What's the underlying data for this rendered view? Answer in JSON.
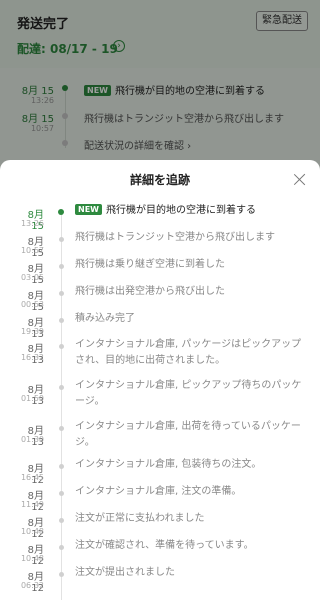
{
  "background": {
    "status_title": "発送完了",
    "urgent_button": "緊急配送",
    "delivery_label": "配達: 08/17 - 19",
    "chevron": "›",
    "rows": [
      {
        "date": "8月 15",
        "time": "13:26",
        "text": "飛行機が目的地の空港に到着する",
        "badge": "NEW"
      },
      {
        "date": "8月 15",
        "time": "10:57",
        "text": "飛行機はトランジット空港から飛び出します"
      },
      {
        "text": "配送状況の詳細を確認 ›"
      }
    ]
  },
  "sheet": {
    "title": "詳細を追跡",
    "events": [
      {
        "date": "8月 15",
        "time": "13:26",
        "text": "飛行機が目的地の空港に到着する",
        "badge": "NEW",
        "active": true
      },
      {
        "date": "8月 15",
        "time": "10:57",
        "text": "飛行機はトランジット空港から飛び出します"
      },
      {
        "date": "8月 15",
        "time": "03:05",
        "text": "飛行機は乗り継ぎ空港に到着した"
      },
      {
        "date": "8月 15",
        "time": "00:53",
        "text": "飛行機は出発空港から飛び出した"
      },
      {
        "date": "8月 13",
        "time": "19:39",
        "text": "積み込み完了"
      },
      {
        "date": "8月 13",
        "time": "16:32",
        "text": "インタナショナル倉庫, パッケージはピックアップされ、目的地に出荷されました。"
      },
      {
        "date": "8月 13",
        "time": "01:50",
        "text": "インタナショナル倉庫, ピックアップ待ちのパッケージ。"
      },
      {
        "date": "8月 13",
        "time": "01:30",
        "text": "インタナショナル倉庫, 出荷を待っているパッケージ。"
      },
      {
        "date": "8月 12",
        "time": "16:45",
        "text": "インタナショナル倉庫, 包装待ちの注文。"
      },
      {
        "date": "8月 12",
        "time": "11:49",
        "text": "インタナショナル倉庫, 注文の準備。"
      },
      {
        "date": "8月 12",
        "time": "10:48",
        "text": "注文が正常に支払われました"
      },
      {
        "date": "8月 12",
        "time": "10:48",
        "text": "注文が確認され、準備を待っています。"
      },
      {
        "date": "8月 12",
        "time": "06:32",
        "text": "注文が提出されました"
      }
    ]
  },
  "colors": {
    "accent": "#2e8a3f",
    "overlay": "rgba(0,0,0,0.38)"
  },
  "icons": [
    "close-icon",
    "chevron-right-icon",
    "timeline-dot-icon"
  ]
}
